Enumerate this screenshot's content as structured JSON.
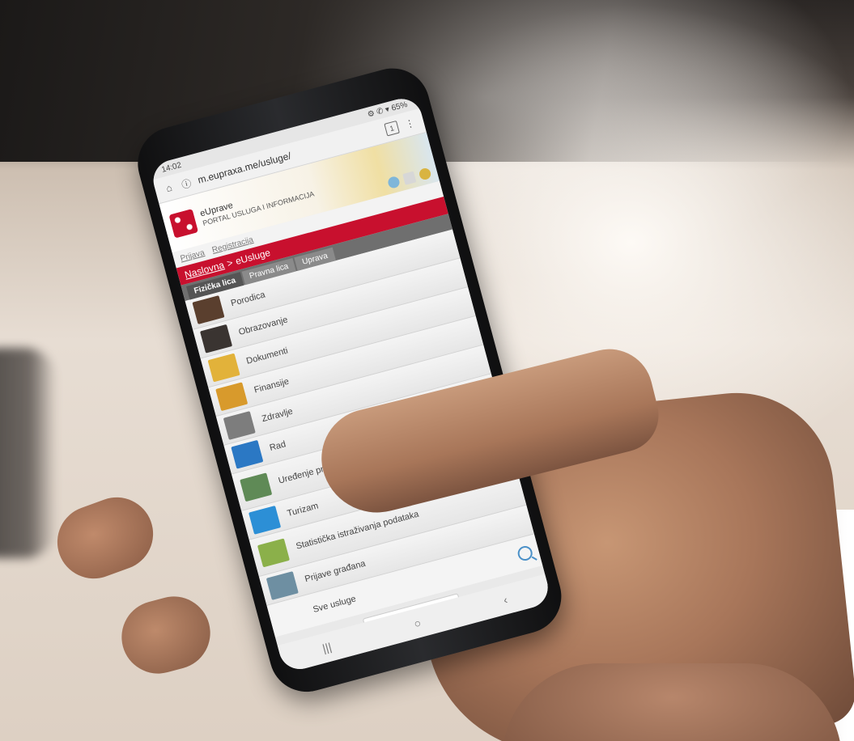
{
  "status": {
    "time": "14:02",
    "indicators": "⚙ ✆ ▾ 65%"
  },
  "browser": {
    "url": "m.eupraxa.me/usluge/",
    "tab_count": "1"
  },
  "site": {
    "name": "eUprave",
    "subtitle": "PORTAL USLUGA I INFORMACIJA"
  },
  "login": {
    "login_label": "Prijava",
    "register_label": "Registracija"
  },
  "breadcrumb": {
    "home": "Naslovna",
    "separator": ">",
    "current": "eUsluge"
  },
  "tabs": [
    {
      "label": "Fizička lica"
    },
    {
      "label": "Pravna lica"
    },
    {
      "label": "Uprava"
    }
  ],
  "items": [
    {
      "label": "Porodica",
      "color": "#5a3f2e"
    },
    {
      "label": "Obrazovanje",
      "color": "#3a3431"
    },
    {
      "label": "Dokumenti",
      "color": "#e2b23a"
    },
    {
      "label": "Finansije",
      "color": "#d89a2c"
    },
    {
      "label": "Zdravlje",
      "color": "#7d7d7d"
    },
    {
      "label": "Rad",
      "color": "#2b78c4"
    },
    {
      "label": "Uređenje prostora, izgradnja objekata",
      "color": "#5f8a56"
    },
    {
      "label": "Turizam",
      "color": "#2c8fd6"
    },
    {
      "label": "Statistička istraživanja podataka",
      "color": "#8bb04a"
    },
    {
      "label": "Prijave građana",
      "color": "#6e8fa2"
    }
  ],
  "search": {
    "label": "Sve usluge",
    "placeholder": "Pretraži"
  },
  "navbar": {
    "recent": "|||",
    "home": "○",
    "back": "‹"
  }
}
